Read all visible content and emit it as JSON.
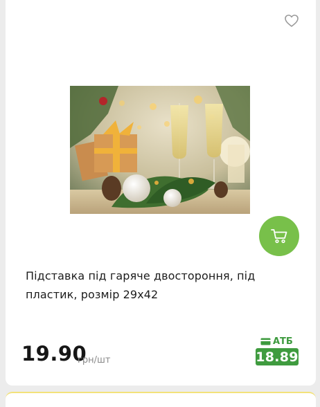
{
  "product": {
    "title": "Підставка під гаряче двостороння, під пластик, розмір 29x42",
    "price": "19.90",
    "unit": "грн/шт",
    "atb_label": "АТБ",
    "atb_price": "18.89"
  },
  "icons": {
    "favorite": "heart-outline-icon",
    "cart": "cart-icon",
    "card": "card-icon"
  },
  "colors": {
    "accent_green": "#78c04a",
    "promo_green": "#3f9b3f",
    "text": "#1c1c1c",
    "muted": "#8a8a8a"
  }
}
